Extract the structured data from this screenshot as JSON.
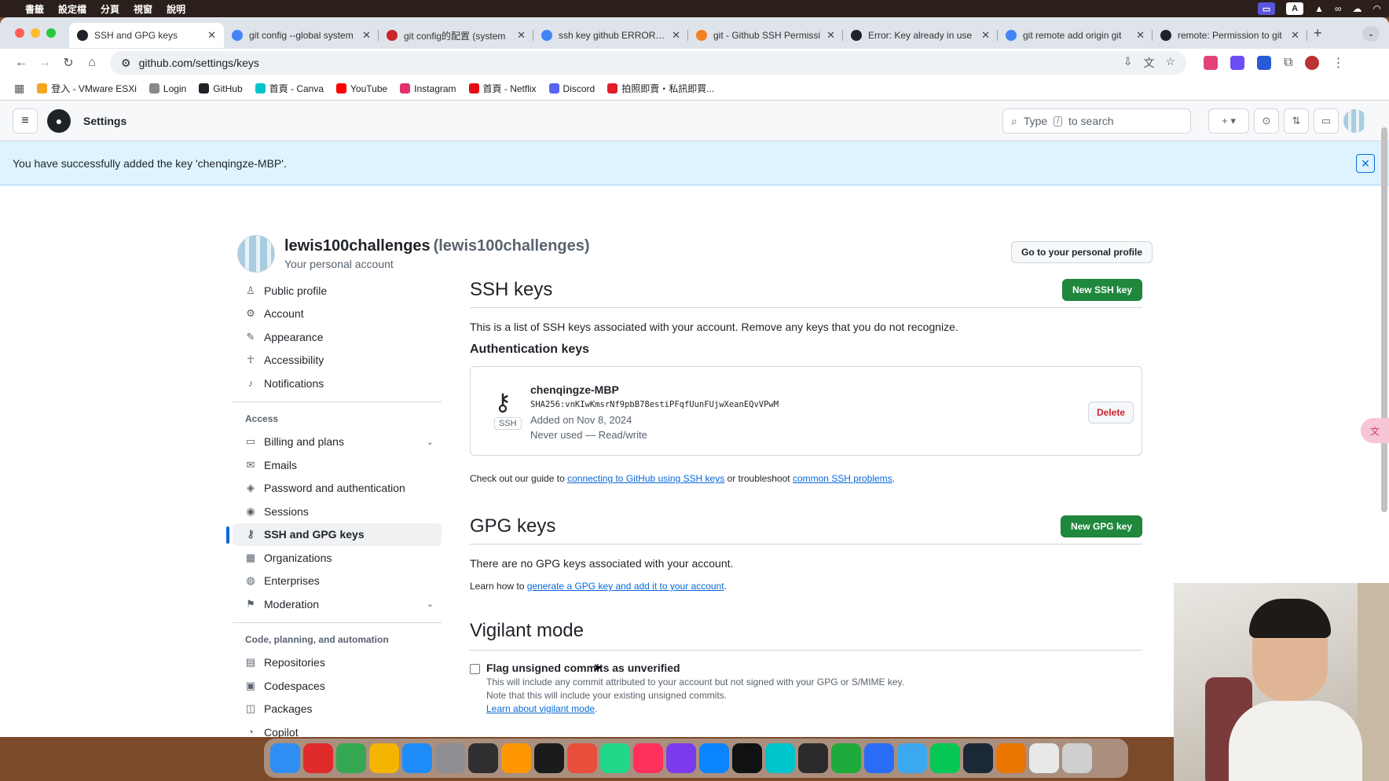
{
  "menubar": {
    "items": [
      "書籤",
      "設定檔",
      "分頁",
      "視窗",
      "說明"
    ],
    "right_label": "A"
  },
  "tabs": [
    {
      "title": "SSH and GPG keys",
      "active": true,
      "favicon": "github",
      "color": "#1f2328"
    },
    {
      "title": "git config --global system",
      "favicon": "google",
      "color": "#4285f4"
    },
    {
      "title": "git config的配置 (system",
      "favicon": "csdn",
      "color": "#c9252d"
    },
    {
      "title": "ssh key github ERROR: P",
      "favicon": "google",
      "color": "#4285f4"
    },
    {
      "title": "git - Github SSH Permissi",
      "favicon": "stackoverflow",
      "color": "#f48024"
    },
    {
      "title": "Error: Key already in use",
      "favicon": "github",
      "color": "#1f2328"
    },
    {
      "title": "git remote add origin git",
      "favicon": "google",
      "color": "#4285f4"
    },
    {
      "title": "remote: Permission to git",
      "favicon": "github",
      "color": "#1f2328"
    }
  ],
  "browser": {
    "url": "github.com/settings/keys"
  },
  "bookmarks": [
    {
      "label": "登入 - VMware ESXi",
      "color": "#f5a623"
    },
    {
      "label": "Login",
      "color": "#888"
    },
    {
      "label": "GitHub",
      "color": "#1f2328"
    },
    {
      "label": "首頁 - Canva",
      "color": "#00c4cc"
    },
    {
      "label": "YouTube",
      "color": "#ff0000"
    },
    {
      "label": "Instagram",
      "color": "#e1306c"
    },
    {
      "label": "首頁 - Netflix",
      "color": "#e50914"
    },
    {
      "label": "Discord",
      "color": "#5865f2"
    },
    {
      "label": "拍照即賣・私訊即買...",
      "color": "#e11d2a"
    }
  ],
  "header": {
    "title": "Settings",
    "search_prefix": "Type",
    "search_key": "/",
    "search_suffix": "to search"
  },
  "flash": {
    "message": "You have successfully added the key 'chenqingze-MBP'."
  },
  "account": {
    "name": "lewis100challenges",
    "login": "(lewis100challenges)",
    "sub": "Your personal account",
    "profile_button": "Go to your personal profile"
  },
  "sidebar": {
    "items": [
      {
        "label": "Public profile",
        "icon": "person-icon"
      },
      {
        "label": "Account",
        "icon": "gear-icon"
      },
      {
        "label": "Appearance",
        "icon": "paintbrush-icon"
      },
      {
        "label": "Accessibility",
        "icon": "accessibility-icon"
      },
      {
        "label": "Notifications",
        "icon": "bell-icon"
      }
    ],
    "access_header": "Access",
    "access_items": [
      {
        "label": "Billing and plans",
        "icon": "credit-card-icon",
        "expand": true
      },
      {
        "label": "Emails",
        "icon": "mail-icon"
      },
      {
        "label": "Password and authentication",
        "icon": "shield-icon"
      },
      {
        "label": "Sessions",
        "icon": "broadcast-icon"
      },
      {
        "label": "SSH and GPG keys",
        "icon": "key-icon",
        "active": true
      },
      {
        "label": "Organizations",
        "icon": "organization-icon"
      },
      {
        "label": "Enterprises",
        "icon": "globe-icon"
      },
      {
        "label": "Moderation",
        "icon": "report-icon",
        "expand": true
      }
    ],
    "code_header": "Code, planning, and automation",
    "code_items": [
      {
        "label": "Repositories",
        "icon": "repo-icon"
      },
      {
        "label": "Codespaces",
        "icon": "codespaces-icon"
      },
      {
        "label": "Packages",
        "icon": "package-icon"
      },
      {
        "label": "Copilot",
        "icon": "copilot-icon"
      }
    ]
  },
  "ssh": {
    "title": "SSH keys",
    "new_button": "New SSH key",
    "description": "This is a list of SSH keys associated with your account. Remove any keys that you do not recognize.",
    "auth_title": "Authentication keys",
    "key": {
      "name": "chenqingze-MBP",
      "fingerprint": "SHA256:vnKIwKmsrNf9pbB78estiPFqfUunFUjwXeanEQvVPwM",
      "added": "Added on Nov 8, 2024",
      "usage": "Never used — Read/write",
      "type_label": "SSH",
      "delete_button": "Delete"
    },
    "guide_prefix": "Check out our guide to",
    "guide_link": "connecting to GitHub using SSH keys",
    "guide_mid": "or troubleshoot",
    "guide_link2": "common SSH problems",
    "guide_end": "."
  },
  "gpg": {
    "title": "GPG keys",
    "new_button": "New GPG key",
    "empty": "There are no GPG keys associated with your account.",
    "learn_prefix": "Learn how to",
    "learn_link": "generate a GPG key and add it to your account",
    "learn_end": "."
  },
  "vigilant": {
    "title": "Vigilant mode",
    "checkbox_label": "Flag unsigned commits as unverified",
    "checked": false,
    "desc1": "This will include any commit attributed to your account but not signed with your GPG or S/MIME key.",
    "desc2": "Note that this will include your existing unsigned commits.",
    "link": "Learn about vigilant mode",
    "link_end": "."
  },
  "dock": {
    "apps": [
      {
        "name": "finder",
        "color": "#2f8ef4"
      },
      {
        "name": "recorder",
        "color": "#e02b2b"
      },
      {
        "name": "chrome",
        "color": "#34a853"
      },
      {
        "name": "photos",
        "color": "#f4b400"
      },
      {
        "name": "app-store",
        "color": "#1d8cf8"
      },
      {
        "name": "settings",
        "color": "#8e8e93"
      },
      {
        "name": "obs",
        "color": "#302e31"
      },
      {
        "name": "sublime",
        "color": "#ff9800"
      },
      {
        "name": "terminal",
        "color": "#1b1b1b"
      },
      {
        "name": "xmind",
        "color": "#e94e3c"
      },
      {
        "name": "pycharm",
        "color": "#21d789"
      },
      {
        "name": "intellij",
        "color": "#fe315d"
      },
      {
        "name": "obsidian",
        "color": "#7c3aed"
      },
      {
        "name": "fl",
        "color": "#0a84ff"
      },
      {
        "name": "capcut",
        "color": "#111"
      },
      {
        "name": "canva",
        "color": "#00c4cc"
      },
      {
        "name": "davinci",
        "color": "#2b2b2b"
      },
      {
        "name": "numbers",
        "color": "#1eab3c"
      },
      {
        "name": "voice",
        "color": "#2a6cf5"
      },
      {
        "name": "airmail",
        "color": "#3ba8f0"
      },
      {
        "name": "line",
        "color": "#06c755"
      },
      {
        "name": "steam",
        "color": "#1b2838"
      },
      {
        "name": "blender",
        "color": "#ea7600"
      },
      {
        "name": "textedit",
        "color": "#e8e8e8"
      },
      {
        "name": "trash",
        "color": "#cfcfcf"
      }
    ]
  }
}
